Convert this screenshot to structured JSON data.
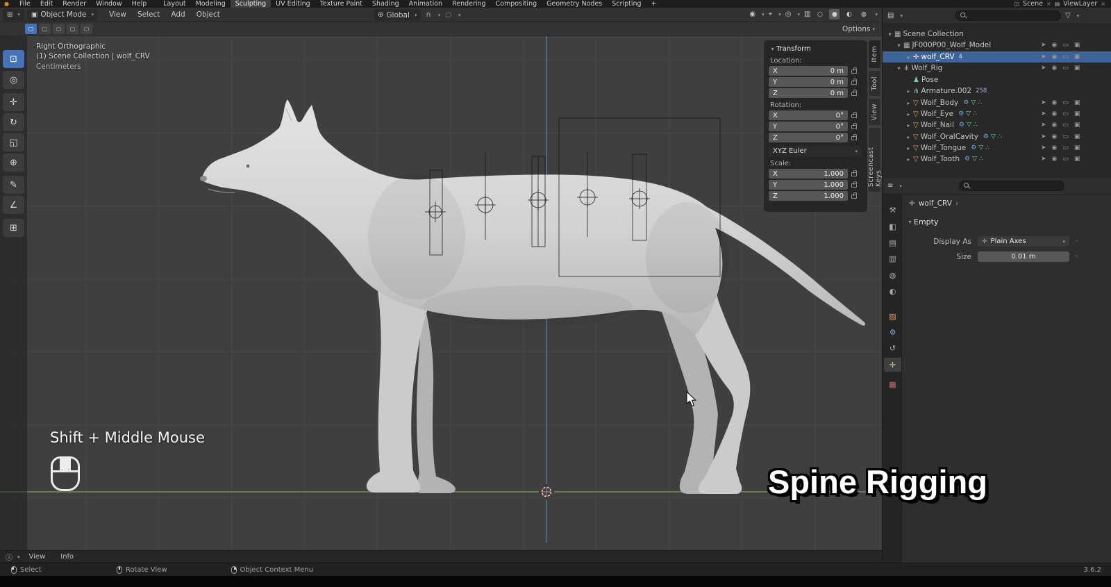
{
  "icons": {
    "dropdown": "▾",
    "expand": "▸",
    "collapse": "▾",
    "blender_logo": "●",
    "menu_editor": "⊞",
    "mode_icon": "▣",
    "global_orientation": "⊕",
    "snap_magnet": "∩",
    "proportional": "◌",
    "visibility": "◉",
    "gizmo": "⌖",
    "overlays": "◎",
    "xray": "▥",
    "shade_wireframe": "○",
    "shade_solid": "●",
    "shade_material": "◐",
    "shade_rendered": "◍",
    "preset": "▢",
    "tool_select": "⊡",
    "tool_cursor": "◎",
    "tool_move": "✛",
    "tool_rotate": "↻",
    "tool_scale": "◱",
    "tool_transform": "⊕",
    "tool_annotate": "✎",
    "tool_measure": "∠",
    "tool_primitive": "⊞",
    "collection": "▦",
    "empty_axes": "✛",
    "armature": "⋔",
    "pose": "♟",
    "bone_data": "⋔",
    "mesh": "▽",
    "modifier": "⚙",
    "mesh_data": "▽",
    "vertex_group": "∴",
    "restrict_select": "➤",
    "restrict_hide": "◉",
    "restrict_viewport": "▭",
    "restrict_render": "▣",
    "filter": "▽",
    "close": "×",
    "scene_icon": "◫",
    "viewlayer_icon": "▤",
    "info": "ⓘ",
    "chevron": "›",
    "anim_dot": "◦",
    "outliner_editor": "▤",
    "props_editor": "≡",
    "ptab_tool": "⚒",
    "ptab_render": "◧",
    "ptab_output": "▤",
    "ptab_viewlayer": "▥",
    "ptab_scene": "◍",
    "ptab_world": "◐",
    "ptab_object": "▨",
    "ptab_modifiers": "⚙",
    "ptab_physics": "↺",
    "ptab_data": "✛",
    "ptab_texture": "▦"
  },
  "topbar": {
    "menus": [
      "File",
      "Edit",
      "Render",
      "Window",
      "Help"
    ],
    "workspaces": [
      "Layout",
      "Modeling",
      "Sculpting",
      "UV Editing",
      "Texture Paint",
      "Shading",
      "Animation",
      "Rendering",
      "Compositing",
      "Geometry Nodes",
      "Scripting"
    ],
    "add_workspace": "+",
    "scene": "Scene",
    "view_layer": "ViewLayer"
  },
  "viewport": {
    "header": {
      "mode": "Object Mode",
      "menus": [
        "View",
        "Select",
        "Add",
        "Object"
      ],
      "orientation": "Global",
      "options": "Options"
    },
    "overlay": {
      "line1": "Right Orthographic",
      "line2": "(1) Scene Collection | wolf_CRV",
      "line3": "Centimeters"
    },
    "side_tabs": [
      "Item",
      "Tool",
      "View",
      "Screencast Keys"
    ]
  },
  "npanel": {
    "title": "Transform",
    "location_label": "Location:",
    "rotation_label": "Rotation:",
    "scale_label": "Scale:",
    "euler": "XYZ Euler",
    "location": [
      {
        "axis": "X",
        "value": "0 m"
      },
      {
        "axis": "Y",
        "value": "0 m"
      },
      {
        "axis": "Z",
        "value": "0 m"
      }
    ],
    "rotation": [
      {
        "axis": "X",
        "value": "0°"
      },
      {
        "axis": "Y",
        "value": "0°"
      },
      {
        "axis": "Z",
        "value": "0°"
      }
    ],
    "scale": [
      {
        "axis": "X",
        "value": "1.000"
      },
      {
        "axis": "Y",
        "value": "1.000"
      },
      {
        "axis": "Z",
        "value": "1.000"
      }
    ]
  },
  "outliner": {
    "items": [
      {
        "label": "Scene Collection"
      },
      {
        "label": "JF000P00_Wolf_Model"
      },
      {
        "label": "wolf_CRV",
        "badge": "4"
      },
      {
        "label": "Wolf_Rig"
      },
      {
        "label": "Pose"
      },
      {
        "label": "Armature.002",
        "badge": "258"
      },
      {
        "label": "Wolf_Body"
      },
      {
        "label": "Wolf_Eye"
      },
      {
        "label": "Wolf_Nail"
      },
      {
        "label": "Wolf_OralCavity"
      },
      {
        "label": "Wolf_Tongue"
      },
      {
        "label": "Wolf_Tooth"
      }
    ]
  },
  "properties": {
    "breadcrumb": "wolf_CRV",
    "panel": "Empty",
    "display_as_label": "Display As",
    "display_as_value": "Plain Axes",
    "size_label": "Size",
    "size_value": "0.01 m"
  },
  "overlays": {
    "hint": "Shift + Middle Mouse",
    "caption": "Spine Rigging"
  },
  "info_bar": {
    "menus": [
      "View",
      "Info"
    ]
  },
  "status_bar": {
    "items": [
      "Select",
      "Rotate View",
      "Object Context Menu"
    ],
    "version": "3.6.2"
  }
}
